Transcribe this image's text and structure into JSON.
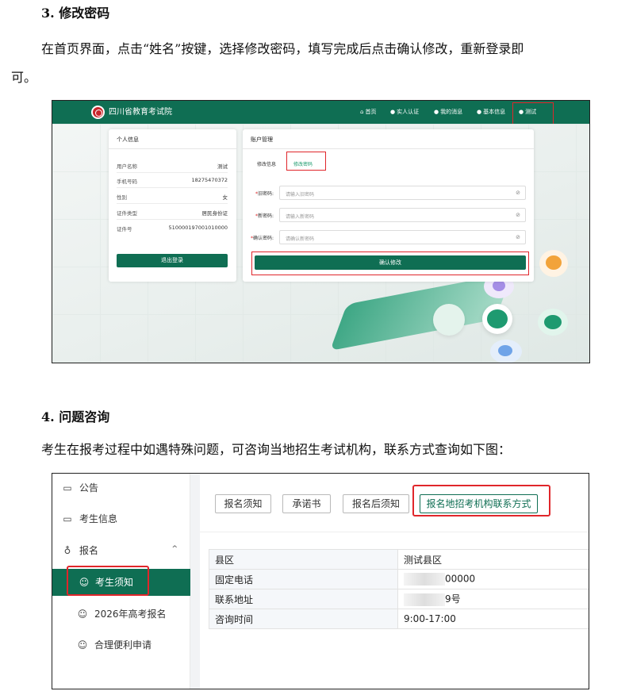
{
  "section3": {
    "heading": "3. 修改密码",
    "para_line1": "在首页界面，点击“姓名”按键，选择修改密码，填写完成后点击确认修改，重新登录即",
    "para_line2": "可。"
  },
  "shot1": {
    "brand": "四川省教育考试院",
    "nav": [
      {
        "icon": "home-icon",
        "label": "首页"
      },
      {
        "icon": "user-icon",
        "label": "实人认证"
      },
      {
        "icon": "user-icon",
        "label": "我的消息"
      },
      {
        "icon": "user-icon",
        "label": "基本信息"
      },
      {
        "icon": "user-icon",
        "label": "测试"
      }
    ],
    "personal_card": {
      "title": "个人信息",
      "rows": [
        {
          "label": "用户名称",
          "value": "测试"
        },
        {
          "label": "手机号码",
          "value": "18275470372"
        },
        {
          "label": "性别",
          "value": "女"
        },
        {
          "label": "证件类型",
          "value": "居民身份证"
        },
        {
          "label": "证件号",
          "value": "510000197001010000"
        }
      ],
      "logout_label": "退出登录"
    },
    "account_card": {
      "title": "账户管理",
      "tab_info": "修改信息",
      "tab_password": "修改密码",
      "fields": [
        {
          "label": "旧密码:",
          "placeholder": "请输入旧密码"
        },
        {
          "label": "新密码:",
          "placeholder": "请输入新密码"
        },
        {
          "label": "确认密码:",
          "placeholder": "请确认新密码"
        }
      ],
      "confirm_label": "确认修改"
    },
    "colors": {
      "brand_green": "#0f6e53",
      "highlight_red": "#e0262b"
    }
  },
  "section4": {
    "heading": "4. 问题咨询",
    "para": "考生在报考过程中如遇特殊问题，可咨询当地招生考试机构，联系方式查询如下图："
  },
  "shot2": {
    "sidebar": [
      {
        "icon": "notice-icon",
        "label": "公告"
      },
      {
        "icon": "id-card-icon",
        "label": "考生信息"
      },
      {
        "icon": "users-icon",
        "label": "报名"
      },
      {
        "icon": "smile-icon",
        "label": "考生须知"
      },
      {
        "icon": "smile-icon",
        "label": "2026年高考报名"
      },
      {
        "icon": "smile-icon",
        "label": "合理便利申请"
      }
    ],
    "tabs": [
      "报名须知",
      "承诺书",
      "报名后须知",
      "报名地招考机构联系方式"
    ],
    "table": [
      {
        "key": "县区",
        "value": "测试县区"
      },
      {
        "key": "固定电话",
        "value": "00000"
      },
      {
        "key": "联系地址",
        "value": "9号"
      },
      {
        "key": "咨询时间",
        "value": "9:00-17:00"
      }
    ]
  }
}
